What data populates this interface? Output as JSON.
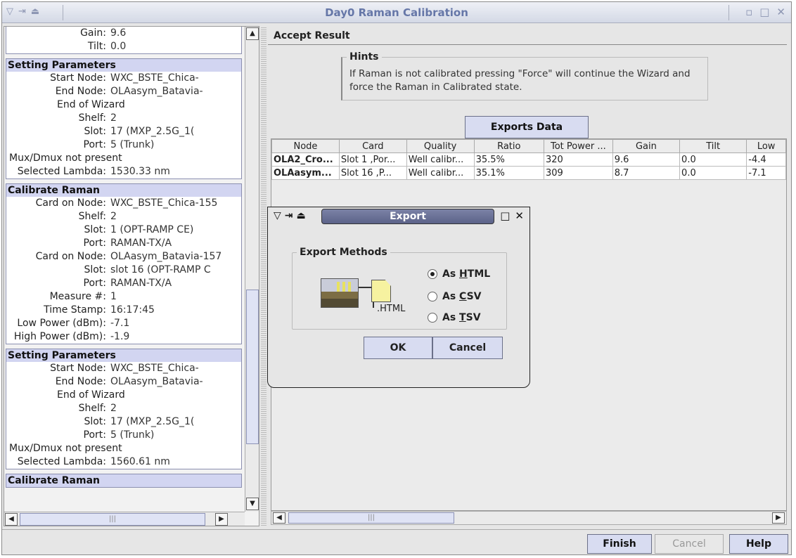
{
  "window": {
    "title": "Day0 Raman Calibration"
  },
  "left_panel": {
    "top_rows": [
      {
        "label": "Gain:",
        "value": "9.6"
      },
      {
        "label": "Tilt:",
        "value": "0.0"
      }
    ],
    "sections": [
      {
        "title": "Setting Parameters",
        "rows": [
          {
            "label": "Start Node:",
            "value": "WXC_BSTE_Chica-"
          },
          {
            "label": "End Node:",
            "value": "OLAasym_Batavia-"
          },
          {
            "full": "End of Wizard",
            "wizard": true
          },
          {
            "label": "Shelf:",
            "value": "2"
          },
          {
            "label": "Slot:",
            "value": "17 (MXP_2.5G_1("
          },
          {
            "label": "Port:",
            "value": "5 (Trunk)"
          },
          {
            "full": "Mux/Dmux not present"
          },
          {
            "label": "Selected Lambda:",
            "value": "1530.33 nm"
          }
        ]
      },
      {
        "title": "Calibrate Raman",
        "rows": [
          {
            "label": "Card on Node:",
            "value": "WXC_BSTE_Chica-155"
          },
          {
            "label": "Shelf:",
            "value": "2"
          },
          {
            "label": "Slot:",
            "value": "1 (OPT-RAMP CE)"
          },
          {
            "label": "Port:",
            "value": "RAMAN-TX/A"
          },
          {
            "label": "Card on Node:",
            "value": "OLAasym_Batavia-157"
          },
          {
            "label": "Slot:",
            "value": "slot 16 (OPT-RAMP C"
          },
          {
            "label": "Port:",
            "value": "RAMAN-TX/A"
          },
          {
            "label": "Measure #:",
            "value": "1"
          },
          {
            "label": "Time Stamp:",
            "value": "16:17:45"
          },
          {
            "label": "Low Power (dBm):",
            "value": "-7.1"
          },
          {
            "label": "High Power (dBm):",
            "value": "-1.9"
          }
        ]
      },
      {
        "title": "Setting Parameters",
        "rows": [
          {
            "label": "Start Node:",
            "value": "WXC_BSTE_Chica-"
          },
          {
            "label": "End Node:",
            "value": "OLAasym_Batavia-"
          },
          {
            "full": "End of Wizard",
            "wizard": true
          },
          {
            "label": "Shelf:",
            "value": "2"
          },
          {
            "label": "Slot:",
            "value": "17 (MXP_2.5G_1("
          },
          {
            "label": "Port:",
            "value": "5 (Trunk)"
          },
          {
            "full": "Mux/Dmux not present"
          },
          {
            "label": "Selected Lambda:",
            "value": "1560.61 nm"
          }
        ]
      },
      {
        "title": "Calibrate Raman",
        "rows": []
      }
    ]
  },
  "accept": {
    "title": "Accept Result",
    "hints_title": "Hints",
    "hints_text": "If Raman is not calibrated pressing \"Force\" will continue the Wizard and force the Raman in Calibrated state.",
    "export_button": "Exports Data"
  },
  "table": {
    "columns": [
      "Node",
      "Card",
      "Quality",
      "Ratio",
      "Tot Power ...",
      "Gain",
      "Tilt",
      "Low"
    ],
    "rows": [
      [
        "OLA2_Cro...",
        "Slot 1 ,Por...",
        "Well calibr...",
        "35.5%",
        "320",
        "9.6",
        "0.0",
        "-4.4"
      ],
      [
        "OLAasym...",
        "Slot 16 ,P...",
        "Well calibr...",
        "35.1%",
        "309",
        "8.7",
        "0.0",
        "-7.1"
      ]
    ]
  },
  "bottom": {
    "finish": "Finish",
    "cancel": "Cancel",
    "help": "Help"
  },
  "dialog": {
    "title": "Export",
    "group_title": "Export Methods",
    "file_label": ".HTML",
    "options": [
      {
        "pre": "As ",
        "key": "H",
        "post": "TML",
        "selected": true
      },
      {
        "pre": "As ",
        "key": "C",
        "post": "SV",
        "selected": false
      },
      {
        "pre": "As ",
        "key": "T",
        "post": "SV",
        "selected": false
      }
    ],
    "ok": "OK",
    "cancel": "Cancel"
  }
}
